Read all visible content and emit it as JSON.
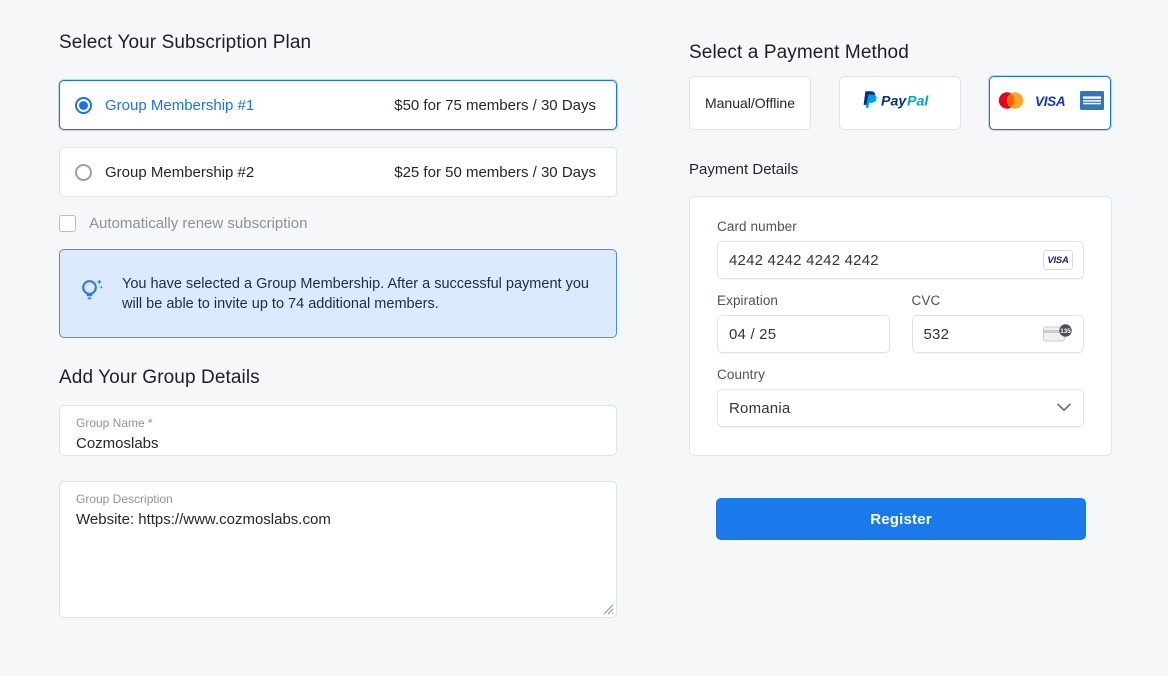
{
  "subscription": {
    "title": "Select Your Subscription Plan",
    "plans": [
      {
        "name": "Group Membership #1",
        "price": "$50 for 75 members / 30 Days",
        "selected": true
      },
      {
        "name": "Group Membership #2",
        "price": "$25 for 50 members / 30 Days",
        "selected": false
      }
    ],
    "auto_renew": {
      "label": "Automatically renew subscription",
      "checked": false
    },
    "notice": {
      "icon": "lightbulb-icon",
      "text": "You have selected a Group Membership. After a successful payment you will be able to invite up to 74 additional members."
    }
  },
  "group_details": {
    "title": "Add Your Group Details",
    "name_field": {
      "label": "Group Name *",
      "value": "Cozmoslabs"
    },
    "description_field": {
      "label": "Group Description",
      "value": "Website: https://www.cozmoslabs.com"
    }
  },
  "payment": {
    "method_title": "Select a Payment Method",
    "methods": [
      {
        "id": "manual",
        "label": "Manual/Offline",
        "kind": "text",
        "selected": false
      },
      {
        "id": "paypal",
        "label": "PayPal",
        "kind": "paypal-logo",
        "selected": false
      },
      {
        "id": "card",
        "label": "Credit Card",
        "kind": "card-logos",
        "selected": true,
        "brands": [
          "mastercard-icon",
          "visa-icon",
          "amex-icon"
        ]
      }
    ],
    "details_title": "Payment Details",
    "card_number": {
      "label": "Card number",
      "value": "4242 4242 4242 4242",
      "brand_badge": "visa-icon",
      "brand_text": "VISA"
    },
    "expiration": {
      "label": "Expiration",
      "value": "04 / 25"
    },
    "cvc": {
      "label": "CVC",
      "value": "532",
      "hint_icon": "cvc-card-icon",
      "hint_number": "135"
    },
    "country": {
      "label": "Country",
      "value": "Romania",
      "chevron": "chevron-down-icon"
    },
    "submit_label": "Register"
  },
  "colors": {
    "accent": "#1a73e8",
    "button": "#1a7aec",
    "notice_bg": "#dbeafe",
    "notice_border": "#4a90e2",
    "page_bg": "#f6f7f8"
  }
}
